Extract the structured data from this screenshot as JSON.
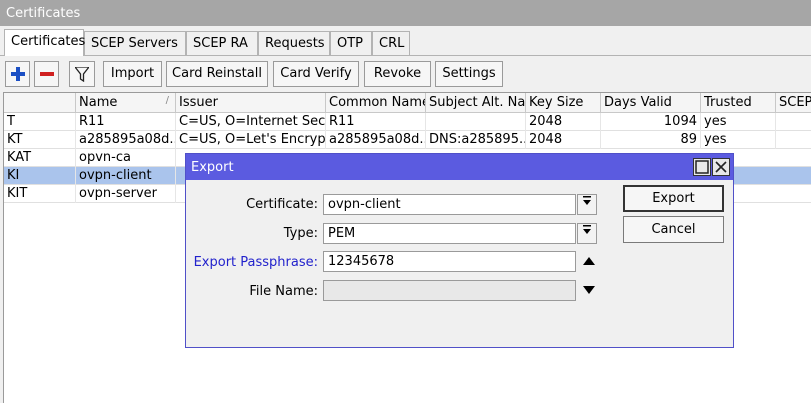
{
  "window": {
    "title": "Certificates"
  },
  "tabs": [
    {
      "label": "Certificates",
      "active": true
    },
    {
      "label": "SCEP Servers"
    },
    {
      "label": "SCEP RA"
    },
    {
      "label": "Requests"
    },
    {
      "label": "OTP"
    },
    {
      "label": "CRL"
    }
  ],
  "toolbar": {
    "add": "+",
    "remove": "−",
    "filter": "filter-icon",
    "import": "Import",
    "card_reinstall": "Card Reinstall",
    "card_verify": "Card Verify",
    "revoke": "Revoke",
    "settings": "Settings"
  },
  "table": {
    "columns": [
      "",
      "Name",
      "Issuer",
      "Common Name",
      "Subject Alt. Na...",
      "Key Size",
      "Days Valid",
      "Trusted",
      "SCEP"
    ],
    "sort_indicator": "/",
    "rows": [
      {
        "flags": "T",
        "name": "R11",
        "issuer": "C=US, O=Internet Secu...",
        "common_name": "R11",
        "san": "",
        "key_size": "2048",
        "days_valid": "1094",
        "trusted": "yes"
      },
      {
        "flags": "KT",
        "name": "a285895a08d...",
        "issuer": "C=US, O=Let's Encrypt...",
        "common_name": "a285895a08d...",
        "san": "DNS:a285895...",
        "key_size": "2048",
        "days_valid": "89",
        "trusted": "yes"
      },
      {
        "flags": "KAT",
        "name": "opvn-ca",
        "issuer": "",
        "common_name": "",
        "san": "",
        "key_size": "",
        "days_valid": "",
        "trusted": ""
      },
      {
        "flags": "KI",
        "name": "ovpn-client",
        "issuer": "",
        "common_name": "",
        "san": "",
        "key_size": "",
        "days_valid": "",
        "trusted": "",
        "selected": true
      },
      {
        "flags": "KIT",
        "name": "ovpn-server",
        "issuer": "",
        "common_name": "",
        "san": "",
        "key_size": "",
        "days_valid": "",
        "trusted": ""
      }
    ]
  },
  "dialog": {
    "title": "Export",
    "certificate_label": "Certificate:",
    "certificate_value": "ovpn-client",
    "type_label": "Type:",
    "type_value": "PEM",
    "passphrase_label": "Export Passphrase:",
    "passphrase_value": "12345678",
    "filename_label": "File Name:",
    "filename_value": "",
    "export_button": "Export",
    "cancel_button": "Cancel",
    "label_accent_color": "#2222cc"
  }
}
